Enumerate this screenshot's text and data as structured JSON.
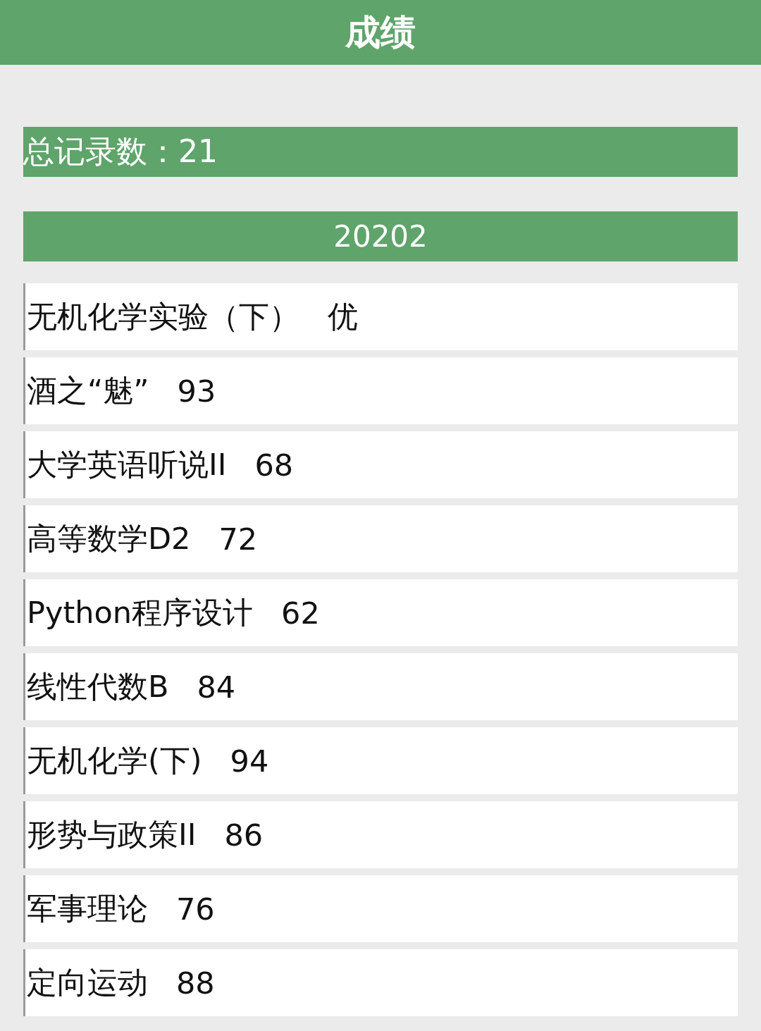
{
  "header": {
    "title": "成绩"
  },
  "total": {
    "label": "总记录数：21"
  },
  "semesters": [
    {
      "term": "20202",
      "courses": [
        {
          "name": "无机化学实验（下）",
          "grade": "优"
        },
        {
          "name": "酒之“魅”",
          "grade": "93"
        },
        {
          "name": "大学英语听说II",
          "grade": "68"
        },
        {
          "name": "高等数学D2",
          "grade": "72"
        },
        {
          "name": "Python程序设计",
          "grade": "62"
        },
        {
          "name": "线性代数B",
          "grade": "84"
        },
        {
          "name": "无机化学(下)",
          "grade": "94"
        },
        {
          "name": "形势与政策II",
          "grade": "86"
        },
        {
          "name": "军事理论",
          "grade": "76"
        },
        {
          "name": "定向运动",
          "grade": "88"
        }
      ]
    }
  ]
}
